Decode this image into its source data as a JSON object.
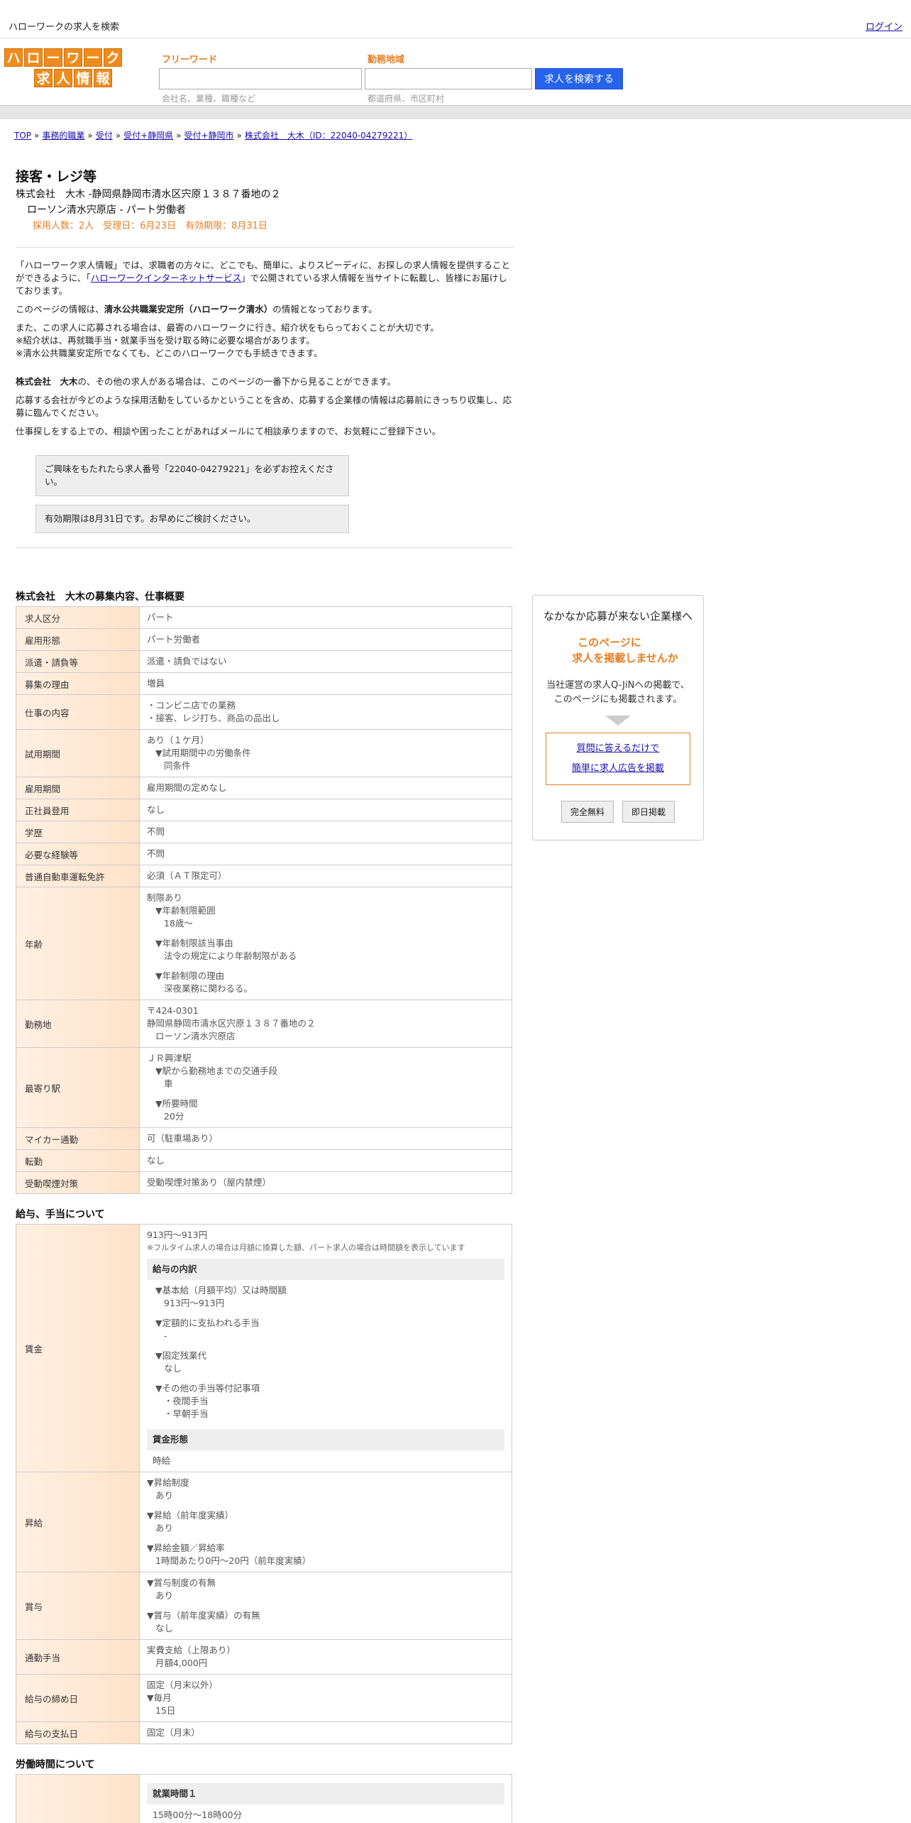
{
  "topbar": {
    "site_title": "ハローワークの求人を検索",
    "login": "ログイン"
  },
  "logo": {
    "row1": [
      "ハ",
      "ロ",
      "ー",
      "ワ",
      "ー",
      "ク"
    ],
    "row2": [
      "求",
      "人",
      "情",
      "報"
    ]
  },
  "search": {
    "freeword_label": "フリーワード",
    "freeword_placeholder": "会社名、業種、職種など",
    "location_label": "勤務地域",
    "location_placeholder": "都道府県、市区町村",
    "button": "人を検索する",
    "button_prefix": "求"
  },
  "breadcrumb": [
    "TOP",
    "事務的職業",
    "受付",
    "受付+静岡県",
    "受付+静岡市",
    "株式会社　大木（ID：22040-04279221）"
  ],
  "job": {
    "title": "接客・レジ等",
    "company_line": "株式会社　大木 -静岡県静岡市清水区宍原１３８７番地の２",
    "store_line": "ローソン清水宍原店 - パート労働者",
    "meta_line": "採用人数：2人　受理日：6月23日　有効期限：8月31日"
  },
  "intro": {
    "p1a": "「ハローワーク求人情報」では、求職者の方々に、どこでも、簡単に、よりスピーディに、お探しの求人情報を提供することができるように、「",
    "p1link": "ハローワークインターネットサービス",
    "p1b": "」で公開されている求人情報を当サイトに転載し、皆様にお届けしております。",
    "p2a": "このページの情報は、",
    "p2b": "清水公共職業安定所（ハローワーク清水）",
    "p2c": "の情報となっております。",
    "p3": "また、この求人に応募される場合は、最寄のハローワークに行き、紹介状をもらっておくことが大切です。",
    "p3b": "※紹介状は、再就職手当・就業手当を受け取る時に必要な場合があります。",
    "p3c": "※清水公共職業安定所でなくても、どこのハローワークでも手続きできます。",
    "p4a": "株式会社　大木",
    "p4b": "の、その他の求人がある場合は、このページの一番下から見ることができます。",
    "p5": "応募する会社が今どのような採用活動をしているかということを含め、応募する企業様の情報は応募前にきっちり収集し、応募に臨んでください。",
    "p6": "仕事探しをする上での、相談や困ったことがあればメールにて相談承りますので、お気軽にご登録下さい。"
  },
  "notices": [
    "ご興味をもたれたら求人番号「22040-04279221」を必ずお控えください。",
    "有効期限は8月31日です。お早めにご検討ください。"
  ],
  "section1": {
    "title": "株式会社　大木の募集内容、仕事概要",
    "rows": [
      {
        "h": "求人区分",
        "v": [
          "パート"
        ]
      },
      {
        "h": "雇用形態",
        "v": [
          "パート労働者"
        ]
      },
      {
        "h": "派遣・請負等",
        "v": [
          "派遣・請負ではない"
        ]
      },
      {
        "h": "募集の理由",
        "v": [
          "増員"
        ]
      },
      {
        "h": "仕事の内容",
        "v": [
          "・コンビニ店での業務",
          "・接客、レジ打ち、商品の品出し"
        ]
      },
      {
        "h": "試用期間",
        "v": [
          "あり（１ケ月）",
          "▼試用期間中の労働条件",
          "同条件"
        ]
      },
      {
        "h": "雇用期間",
        "v": [
          "雇用期間の定めなし"
        ]
      },
      {
        "h": "正社員登用",
        "v": [
          "なし"
        ]
      },
      {
        "h": "学歴",
        "v": [
          "不問"
        ]
      },
      {
        "h": "必要な経験等",
        "v": [
          "不問"
        ]
      },
      {
        "h": "普通自動車運転免許",
        "v": [
          "必須（ＡＴ限定可）"
        ]
      },
      {
        "h": "年齢",
        "v": [
          "制限あり",
          "▼年齢制限範囲",
          "18歳〜",
          "▼年齢制限該当事由",
          "法令の規定により年齢制限がある",
          "▼年齢制限の理由",
          "深夜業務に関わるる。"
        ]
      },
      {
        "h": "勤務地",
        "v": [
          "〒424-0301",
          "静岡県静岡市清水区宍原１３８７番地の２",
          "ローソン清水宍原店"
        ]
      },
      {
        "h": "最寄り駅",
        "v": [
          "ＪＲ興津駅",
          "▼駅から勤務地までの交通手段",
          "車",
          "▼所要時間",
          "20分"
        ]
      },
      {
        "h": "マイカー通勤",
        "v": [
          "可（駐車場あり）"
        ]
      },
      {
        "h": "転勤",
        "v": [
          "なし"
        ]
      },
      {
        "h": "受動喫煙対策",
        "v": [
          "受動喫煙対策あり（屋内禁煙）"
        ]
      }
    ]
  },
  "section2": {
    "title": "給与、手当について",
    "wage": {
      "h": "賃金",
      "range": "913円〜913円",
      "note": "※フルタイム求人の場合は月額に換算した額、パート求人の場合は時間額を表示しています",
      "breakdown_title": "給与の内訳",
      "items": [
        "▼基本給（月額平均）又は時間額",
        "913円〜913円",
        "▼定額的に支払われる手当",
        "-",
        "▼固定残業代",
        "なし",
        "▼その他の手当等付記事項",
        "・夜間手当",
        "・早朝手当"
      ],
      "form_title": "賃金形態",
      "form": "時給"
    },
    "raise": {
      "h": "昇給",
      "v": [
        "▼昇給制度",
        "あり",
        "▼昇給（前年度実績）",
        "あり",
        "▼昇給金額／昇給率",
        "1時間あたり0円〜20円（前年度実績）"
      ]
    },
    "bonus": {
      "h": "賞与",
      "v": [
        "▼賞与制度の有無",
        "あり",
        "▼賞与（前年度実績）の有無",
        "なし"
      ]
    },
    "commute": {
      "h": "通勤手当",
      "v": [
        "実費支給（上限あり）",
        "月額4,000円"
      ]
    },
    "closing": {
      "h": "給与の締め日",
      "v": [
        "固定（月末以外）",
        "▼毎月",
        "15日"
      ]
    },
    "payday": {
      "h": "給与の支払日",
      "v": [
        "固定（月末）"
      ]
    }
  },
  "section3": {
    "title": "労働時間について",
    "sub": "就業時間１",
    "time": "15時00分〜18時00分"
  },
  "sidebox": {
    "heading": "なかなか応募が来ない企業様へ",
    "orange1": "このページに",
    "orange2": "求人を掲載しませんか",
    "desc1": "当社運営の求人Q-JiNへの掲載で、",
    "desc2": "このページにも掲載されます。",
    "link1": "質問に答えるだけで",
    "link2": "簡単に求人広告を掲載",
    "btn1": "完全無料",
    "btn2": "即日掲載"
  }
}
